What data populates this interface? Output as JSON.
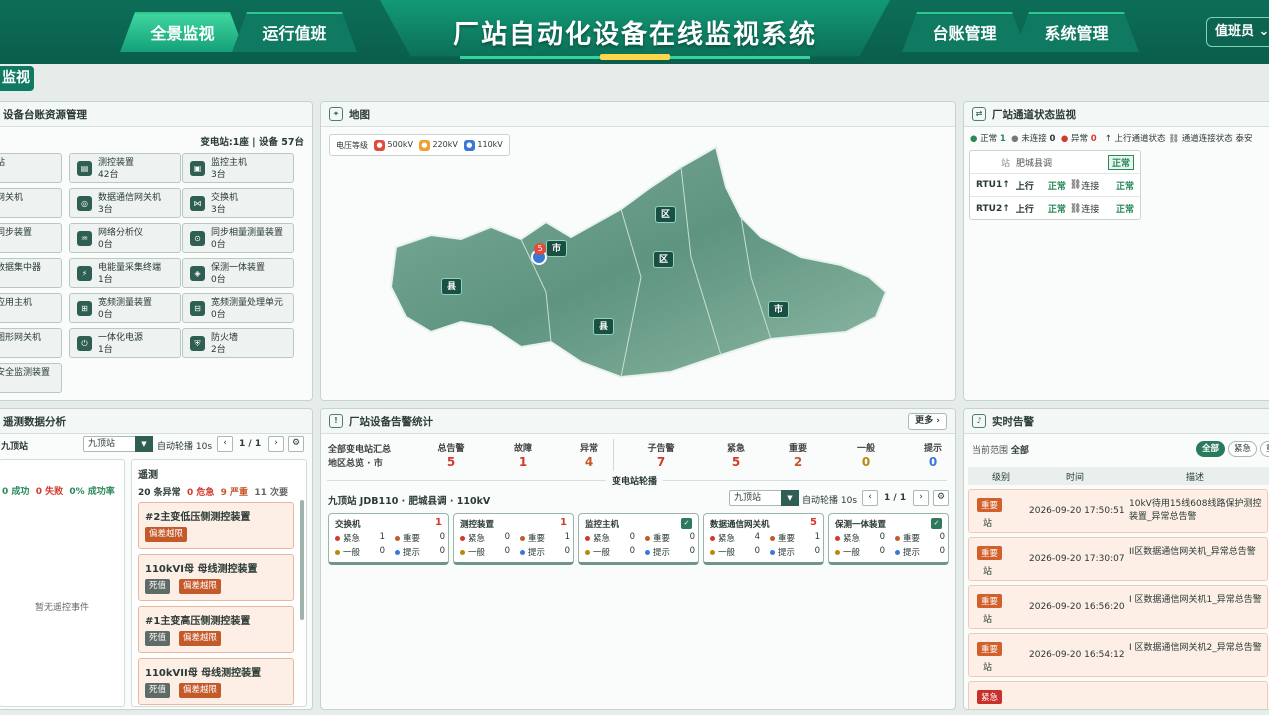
{
  "header": {
    "title": "厂站自动化设备在线监视系统",
    "tabs": [
      "全景监视",
      "运行值班",
      "台账管理",
      "系统管理"
    ],
    "user": "值班员"
  },
  "page_tag": "监视",
  "devices": {
    "title": "设备台账资源管理",
    "summary_station_label": "变电站:",
    "summary_station": "1座",
    "summary_device_label": "设备",
    "summary_device": "57台",
    "items": [
      {
        "name": "站",
        "count": ""
      },
      {
        "name": "测控装置",
        "count": "42台"
      },
      {
        "name": "监控主机",
        "count": "3台"
      },
      {
        "name": "网关机",
        "count": ""
      },
      {
        "name": "数据通信网关机",
        "count": "3台"
      },
      {
        "name": "交换机",
        "count": "3台"
      },
      {
        "name": "同步装置",
        "count": ""
      },
      {
        "name": "网络分析仪",
        "count": "0台"
      },
      {
        "name": "同步相量测量装置",
        "count": "0台"
      },
      {
        "name": "数据集中器",
        "count": ""
      },
      {
        "name": "电能量采集终端",
        "count": "1台"
      },
      {
        "name": "保测一体装置",
        "count": "0台"
      },
      {
        "name": "应用主机",
        "count": ""
      },
      {
        "name": "宽频测量装置",
        "count": "0台"
      },
      {
        "name": "宽频测量处理单元",
        "count": "0台"
      },
      {
        "name": "图形网关机",
        "count": ""
      },
      {
        "name": "一体化电源",
        "count": "1台"
      },
      {
        "name": "防火墙",
        "count": "2台"
      },
      {
        "name": "安全监测装置",
        "count": ""
      }
    ]
  },
  "map": {
    "title": "地图",
    "legend_label": "电压等级",
    "legend": [
      {
        "label": "500kV",
        "color": "#e04b3a"
      },
      {
        "label": "220kV",
        "color": "#f0a030"
      },
      {
        "label": "110kV",
        "color": "#3a78d8"
      }
    ],
    "labels": [
      "市",
      "区",
      "区",
      "县",
      "县",
      "市"
    ],
    "marker_count": "5"
  },
  "channel": {
    "title": "厂站通道状态监视",
    "legend": [
      {
        "label": "正常",
        "value": "1",
        "color": "#2a8a5a"
      },
      {
        "label": "未连接",
        "value": "0",
        "color": "#777"
      },
      {
        "label": "异常",
        "value": "0",
        "color": "#d13b2d"
      }
    ],
    "extra": [
      "上行通道状态",
      "通道连接状态",
      "泰安"
    ],
    "station": "站",
    "station_sub": "肥城县调",
    "station_status": "正常",
    "rows": [
      {
        "name": "RTU1",
        "dir": "上行",
        "s1": "正常",
        "link": "连接",
        "s2": "正常"
      },
      {
        "name": "RTU2",
        "dir": "上行",
        "s1": "正常",
        "link": "连接",
        "s2": "正常"
      }
    ]
  },
  "telemetry": {
    "title": "遥测数据分析",
    "station": "九顶站",
    "select": "九顶站",
    "auto": "自动轮播 10s",
    "page": "1 / 1",
    "stats": {
      "success": "0 成功",
      "fail": "0 失败",
      "rate": "0% 成功率"
    },
    "empty": "暂无遥控事件",
    "sub_title": "遥测",
    "summary": [
      {
        "t": "20 条异常",
        "c": "#333"
      },
      {
        "t": "0 危急",
        "c": "#d13b2d"
      },
      {
        "t": "9 严重",
        "c": "#c4592a"
      },
      {
        "t": "11 次要",
        "c": "#555"
      }
    ],
    "cards": [
      {
        "name": "#2主变低压侧测控装置",
        "tags": [
          "偏差越限"
        ]
      },
      {
        "name": "110kVI母 母线测控装置",
        "tags": [
          "死值",
          "偏差越限"
        ]
      },
      {
        "name": "#1主变高压侧测控装置",
        "tags": [
          "死值",
          "偏差越限"
        ]
      },
      {
        "name": "110kVII母 母线测控装置",
        "tags": [
          "死值",
          "偏差越限"
        ]
      }
    ]
  },
  "alarm_stats": {
    "title": "厂站设备告警统计",
    "more": "更多 ›",
    "left1": "全部变电站汇总",
    "left2": "地区总览 · ",
    "left2_city": "市",
    "cols": [
      {
        "label": "总告警",
        "value": "5",
        "color": "#d13b2d"
      },
      {
        "label": "故障",
        "value": "1",
        "color": "#d13b2d"
      },
      {
        "label": "异常",
        "value": "4",
        "color": "#c4592a"
      },
      {
        "label": "子告警",
        "value": "7",
        "color": "#d13b2d"
      },
      {
        "label": "紧急",
        "value": "5",
        "color": "#d13b2d"
      },
      {
        "label": "重要",
        "value": "2",
        "color": "#c4592a"
      },
      {
        "label": "一般",
        "value": "0",
        "color": "#b58a10"
      },
      {
        "label": "提示",
        "value": "0",
        "color": "#3a78d8"
      }
    ],
    "carousel": "变电站轮播",
    "station_line": "九顶站  JDB110 · 肥城县调 · 110kV",
    "select": "九顶站",
    "auto": "自动轮播 10s",
    "page": "1 / 1",
    "cards": [
      {
        "name": "交换机",
        "total": "1",
        "v": [
          "1",
          "0",
          "0",
          "0"
        ]
      },
      {
        "name": "测控装置",
        "total": "1",
        "v": [
          "0",
          "1",
          "0",
          "0"
        ]
      },
      {
        "name": "监控主机",
        "total": "",
        "v": [
          "0",
          "0",
          "0",
          "0"
        ]
      },
      {
        "name": "数据通信网关机",
        "total": "5",
        "v": [
          "4",
          "1",
          "0",
          "0"
        ]
      },
      {
        "name": "保测一体装置",
        "total": "",
        "v": [
          "0",
          "0",
          "0",
          "0"
        ]
      }
    ],
    "card_labels": [
      "紧急",
      "重要",
      "一般",
      "提示"
    ]
  },
  "realtime": {
    "title": "实时告警",
    "scope_label": "当前范围",
    "scope": "全部",
    "filters": [
      "全部",
      "紧急",
      "重"
    ],
    "cols": [
      "级别",
      "时间",
      "描述"
    ],
    "rows": [
      {
        "level": "重要",
        "station": "站",
        "time": "2026-09-20 17:50:51",
        "desc": "10kV待用15线608线路保护测控装置_异常总告警"
      },
      {
        "level": "重要",
        "station": "站",
        "time": "2026-09-20 17:30:07",
        "desc": "II区数据通信网关机_异常总告警"
      },
      {
        "level": "重要",
        "station": "站",
        "time": "2026-09-20 16:56:20",
        "desc": "I 区数据通信网关机1_异常总告警"
      },
      {
        "level": "重要",
        "station": "站",
        "time": "2026-09-20 16:54:12",
        "desc": "I 区数据通信网关机2_异常总告警"
      },
      {
        "level": "紧急",
        "station": "",
        "time": "",
        "desc": ""
      }
    ]
  }
}
